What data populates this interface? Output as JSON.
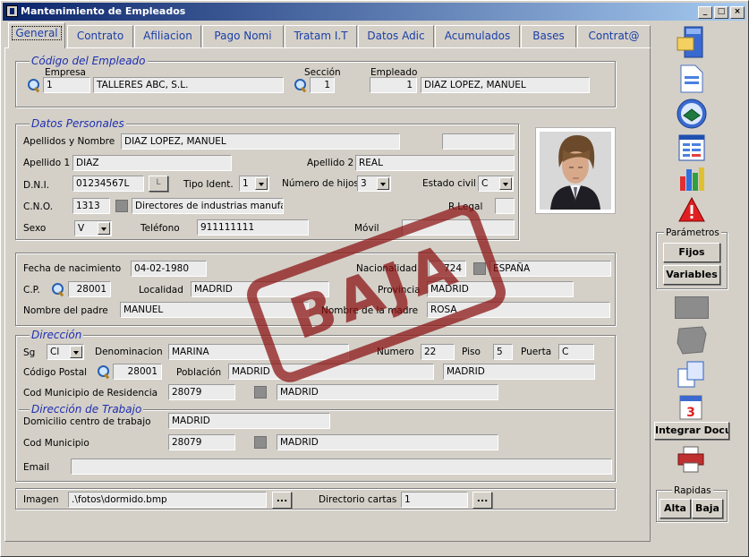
{
  "window": {
    "title": "Mantenimiento de Empleados",
    "min": "_",
    "max": "□",
    "close": "×"
  },
  "tabs": [
    "General",
    "Contrato",
    "Afiliacion",
    "Pago  Nomi",
    "Tratam I.T",
    "Datos Adic",
    "Acumulados",
    "Bases",
    "Contrat@"
  ],
  "codigo": {
    "legend": "Código del Empleado",
    "empresa_label": "Empresa",
    "empresa_code": "1",
    "empresa_name": "TALLERES ABC, S.L.",
    "seccion_label": "Sección",
    "seccion_code": "1",
    "empleado_label": "Empleado",
    "empleado_code": "1",
    "empleado_name": "DIAZ  LOPEZ, MANUEL"
  },
  "personales": {
    "legend": "Datos Personales",
    "apellidos_nombre_label": "Apellidos y Nombre",
    "apellidos_nombre": "DIAZ  LOPEZ, MANUEL",
    "extra": "",
    "apellido1_label": "Apellido 1",
    "apellido1": "DIAZ",
    "apellido2_label": "Apellido 2",
    "apellido2": "REAL",
    "dni_label": "D.N.I.",
    "dni": "01234567L",
    "dni_btn": "L",
    "tipo_ident_label": "Tipo Ident.",
    "tipo_ident": "1",
    "num_hijos_label": "Número de hijos",
    "num_hijos": "3",
    "estado_civil_label": "Estado civil",
    "estado_civil": "C",
    "cno_label": "C.N.O.",
    "cno_code": "1313",
    "cno_desc": "Directores de industrias manufactu",
    "rlegal_label": "R.Legal",
    "rlegal": "",
    "sexo_label": "Sexo",
    "sexo": "V",
    "telefono_label": "Teléfono",
    "telefono": "911111111",
    "movil_label": "Móvil",
    "movil": ""
  },
  "nacimiento": {
    "fecha_label": "Fecha de nacimiento",
    "fecha": "04-02-1980",
    "nacionalidad_label": "Nacionalidad",
    "nac_code": "724",
    "nac_name": "ESPAÑA",
    "cp_label": "C.P.",
    "cp": "28001",
    "localidad_label": "Localidad",
    "localidad": "MADRID",
    "provincia_label": "Provincia",
    "provincia": "MADRID",
    "padre_label": "Nombre del padre",
    "padre": "MANUEL",
    "madre_label": "Nombre de la madre",
    "madre": "ROSA"
  },
  "direccion": {
    "legend": "Dirección",
    "sg_label": "Sg",
    "sg": "Cl",
    "denominacion_label": "Denominacion",
    "denominacion": "MARINA",
    "numero_label": "Numero",
    "numero": "22",
    "piso_label": "Piso",
    "piso": "5",
    "puerta_label": "Puerta",
    "puerta": "C",
    "cp_label": "Código Postal",
    "cp": "28001",
    "poblacion_label": "Población",
    "poblacion": "MADRID",
    "poblacion2": "MADRID",
    "municipio_label": "Cod Municipio de Residencia",
    "municipio_code": "28079",
    "municipio_name": "MADRID"
  },
  "trabajo": {
    "legend": "Dirección de Trabajo",
    "domicilio_label": "Domicilio  centro de trabajo",
    "domicilio": "MADRID",
    "municipio_label": "Cod Municipio",
    "municipio_code": "28079",
    "municipio_name": "MADRID",
    "email_label": "Email",
    "email": ""
  },
  "imagen": {
    "label": "Imagen",
    "path": ".\\fotos\\dormido.bmp",
    "browse": "...",
    "dir_label": "Directorio cartas",
    "dir": "1",
    "dir_browse": "..."
  },
  "stamp": "BAJA",
  "sidebar": {
    "parametros_label": "Parámetros",
    "fijos": "Fijos",
    "variables": "Variables",
    "integrar": "Integrar Docur",
    "rapidas_label": "Rapidas",
    "alta": "Alta",
    "baja": "Baja"
  },
  "colors": {
    "title_start": "#0a246a",
    "title_end": "#a6caf0",
    "legend": "#1f2fb0",
    "stamp": "#8a1010"
  }
}
